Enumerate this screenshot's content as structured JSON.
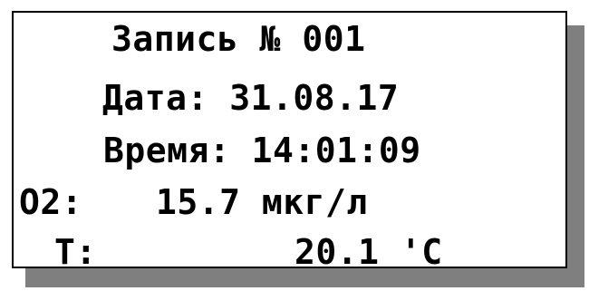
{
  "record": {
    "title": "Запись № 001"
  },
  "date": {
    "text": "Дата: 31.08.17"
  },
  "time": {
    "text": "Время: 14:01:09"
  },
  "o2": {
    "label": "O2:",
    "value": "15.7 мкг/л"
  },
  "temperature": {
    "label": "T:",
    "value": "20.1 'C"
  },
  "colors": {
    "background": "#ffffff",
    "text": "#000000",
    "border": "#000000",
    "shadow": "#7f7f7f"
  }
}
